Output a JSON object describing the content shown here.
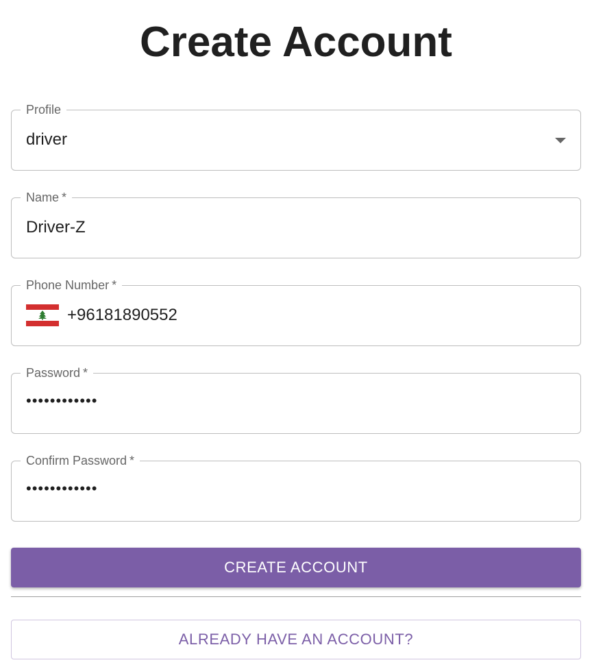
{
  "page": {
    "title": "Create Account"
  },
  "form": {
    "profile": {
      "label": "Profile",
      "value": "driver",
      "icon": "chevron-down-icon"
    },
    "name": {
      "label": "Name",
      "required_marker": "*",
      "value": "Driver-Z"
    },
    "phone": {
      "label": "Phone Number",
      "required_marker": "*",
      "value": "+96181890552",
      "flag_icon": "lebanon-flag-icon"
    },
    "password": {
      "label": "Password",
      "required_marker": "*",
      "value": "••••••••••••"
    },
    "confirm_password": {
      "label": "Confirm Password",
      "required_marker": "*",
      "value": "••••••••••••"
    }
  },
  "actions": {
    "create_account_label": "CREATE ACCOUNT",
    "already_have_account_label": "ALREADY HAVE AN ACCOUNT?"
  },
  "colors": {
    "primary": "#7b5ea7",
    "flag_red": "#d32f2f",
    "cedar_green": "#2e7d32"
  }
}
